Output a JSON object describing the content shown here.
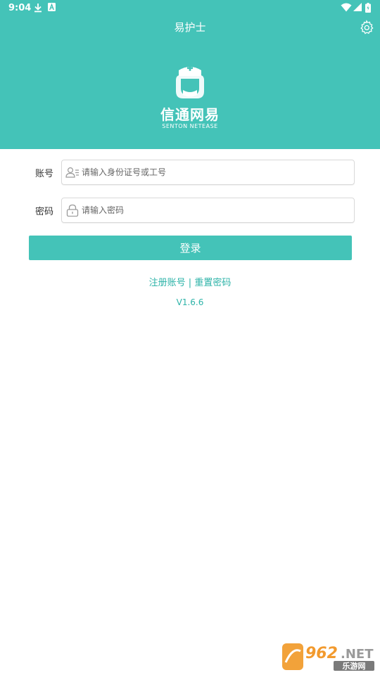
{
  "status_bar": {
    "time": "9:04",
    "icons": [
      "download-icon",
      "keyboard-a-icon",
      "wifi-icon",
      "signal-icon",
      "battery-icon"
    ]
  },
  "app_bar": {
    "title": "易护士",
    "settings_icon": "gear-icon"
  },
  "brand": {
    "name": "信通网易",
    "subtitle": "SENTON NETEASE",
    "logo_icon": "nurse-logo-icon"
  },
  "form": {
    "account_label": "账号",
    "account_placeholder": "请输入身份证号或工号",
    "account_icon": "user-card-icon",
    "password_label": "密码",
    "password_placeholder": "请输入密码",
    "password_icon": "lock-icon"
  },
  "login_label": "登录",
  "links": {
    "register": "注册账号",
    "separator": "|",
    "reset": "重置密码"
  },
  "version": "V1.6.6",
  "watermark_text": "962.NET 乐游网",
  "colors": {
    "primary": "#44c3b8",
    "link": "#2db3a8",
    "border": "#d9d9d9"
  }
}
